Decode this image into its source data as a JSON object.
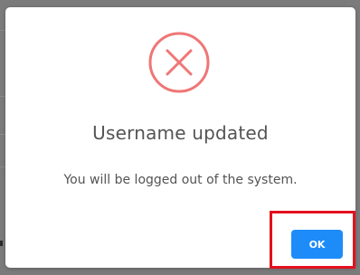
{
  "dialog": {
    "icon": "error-x-circle-icon",
    "title": "Username updated",
    "message": "You will be logged out of the system.",
    "ok_label": "OK"
  },
  "colors": {
    "icon_stroke": "#ef7676",
    "button_bg": "#1d8cf8",
    "highlight_border": "#e3101d",
    "text": "#545454"
  }
}
